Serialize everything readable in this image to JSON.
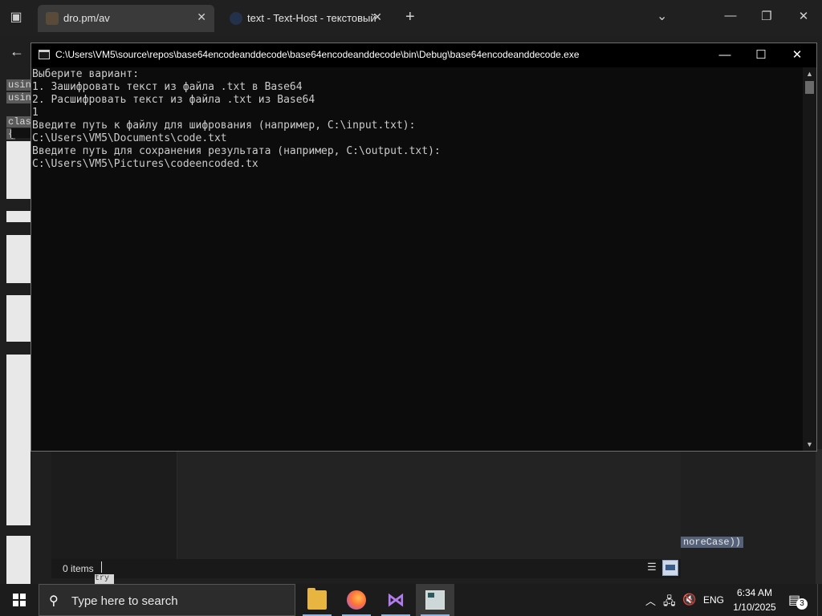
{
  "browser": {
    "tabs": [
      {
        "title": "dro.pm/av",
        "active": true
      },
      {
        "title": "text - Text-Host - текстовый хо",
        "active": false
      }
    ],
    "icons": {
      "tab_actions": "tab-actions-icon",
      "new_tab": "plus-icon",
      "tab_list": "chevron-down-icon"
    },
    "window_controls": {
      "minimize": "—",
      "restore": "❐",
      "close": "✕"
    }
  },
  "background": {
    "code_fragments": [
      "usin",
      "usin",
      "clas",
      "{"
    ],
    "ignorecase_text": "noreCase))",
    "try_text": "try"
  },
  "explorer": {
    "status_items": "0 items"
  },
  "console": {
    "title": "C:\\Users\\VM5\\source\\repos\\base64encodeanddecode\\base64encodeanddecode\\bin\\Debug\\base64encodeanddecode.exe",
    "lines": [
      "Выберите вариант:",
      "1. Зашифровать текст из файла .txt в Base64",
      "2. Расшифровать текст из файла .txt из Base64",
      "1",
      "Введите путь к файлу для шифрования (например, C:\\input.txt):",
      "C:\\Users\\VM5\\Documents\\code.txt",
      "Введите путь для сохранения результата (например, C:\\output.txt):",
      "C:\\Users\\VM5\\Pictures\\codeencoded.tx"
    ],
    "controls": {
      "minimize": "—",
      "maximize": "☐",
      "close": "✕"
    }
  },
  "taskbar": {
    "search_placeholder": "Type here to search",
    "apps": [
      "file-explorer",
      "firefox",
      "visual-studio",
      "console"
    ],
    "tray": {
      "chevron": "︿",
      "language": "ENG"
    },
    "clock": {
      "time": "6:34 AM",
      "date": "1/10/2025"
    },
    "notification_count": "3"
  }
}
